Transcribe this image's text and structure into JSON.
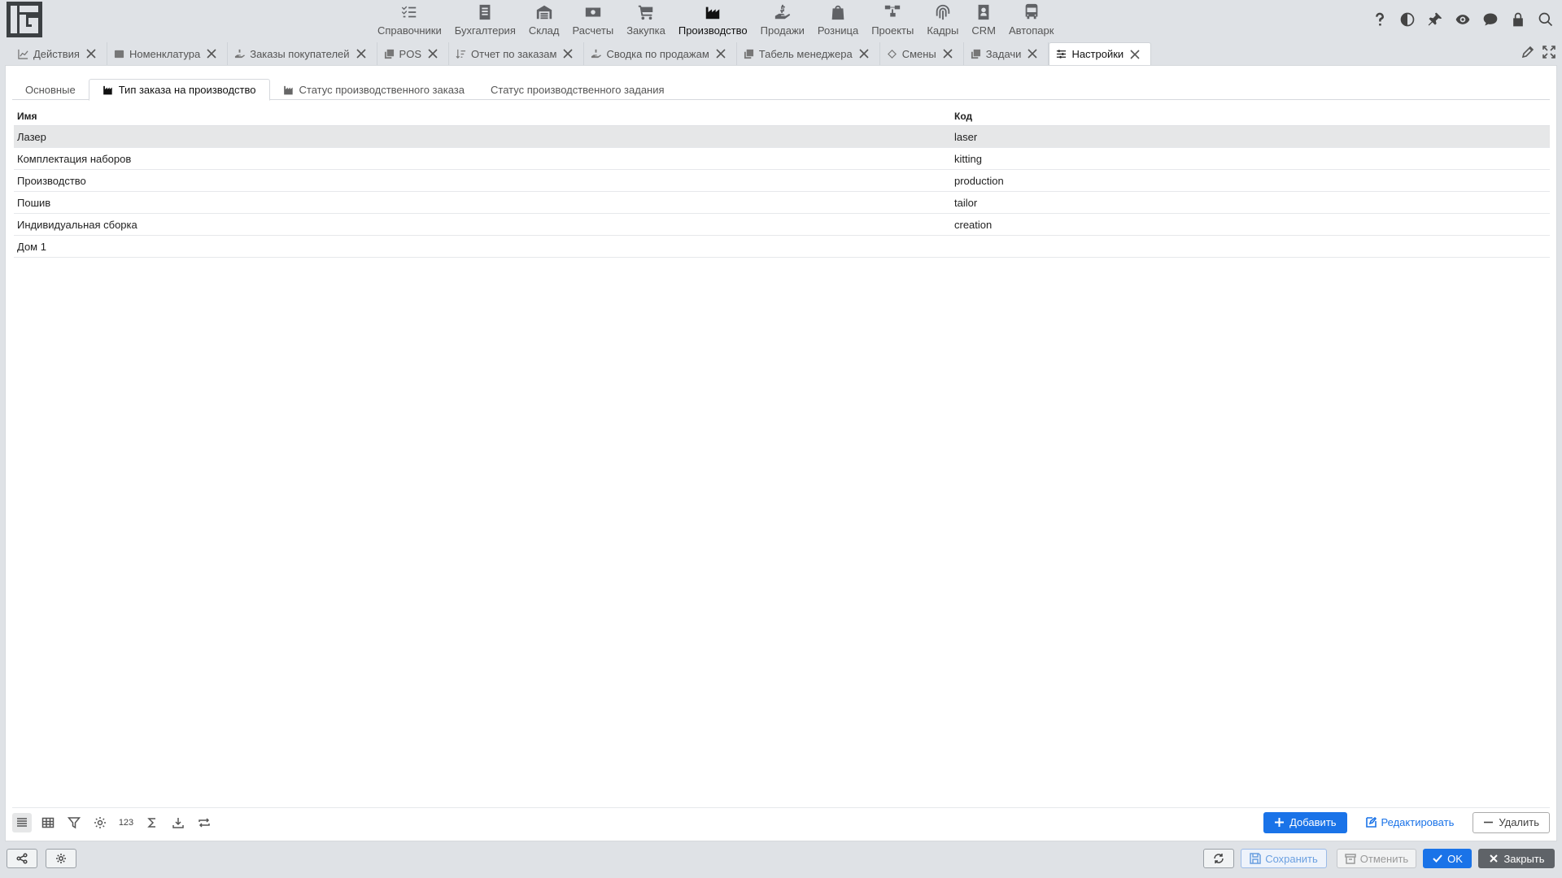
{
  "modules": [
    {
      "label": "Справочники",
      "icon": "checklist-icon"
    },
    {
      "label": "Бухгалтерия",
      "icon": "ledger-icon"
    },
    {
      "label": "Склад",
      "icon": "warehouse-icon"
    },
    {
      "label": "Расчеты",
      "icon": "money-icon"
    },
    {
      "label": "Закупка",
      "icon": "cart-icon"
    },
    {
      "label": "Производство",
      "icon": "factory-icon",
      "active": true
    },
    {
      "label": "Продажи",
      "icon": "hand-money-icon"
    },
    {
      "label": "Розница",
      "icon": "shopping-bag-icon"
    },
    {
      "label": "Проекты",
      "icon": "project-tree-icon"
    },
    {
      "label": "Кадры",
      "icon": "fingerprint-icon"
    },
    {
      "label": "CRM",
      "icon": "contact-card-icon"
    },
    {
      "label": "Автопарк",
      "icon": "bus-icon"
    }
  ],
  "doc_tabs": [
    {
      "label": "Действия",
      "icon": "chart-line-icon"
    },
    {
      "label": "Номенклатура",
      "icon": "catalog-icon"
    },
    {
      "label": "Заказы покупателей",
      "icon": "hand-money-icon"
    },
    {
      "label": "POS",
      "icon": "copy-icon"
    },
    {
      "label": "Отчет по заказам",
      "icon": "sort-icon"
    },
    {
      "label": "Сводка по продажам",
      "icon": "hand-money-icon"
    },
    {
      "label": "Табель менеджера",
      "icon": "copy-icon"
    },
    {
      "label": "Смены",
      "icon": "refresh-icon"
    },
    {
      "label": "Задачи",
      "icon": "copy-icon"
    },
    {
      "label": "Настройки",
      "icon": "sliders-icon",
      "active": true
    }
  ],
  "sub_tabs": [
    {
      "label": "Основные"
    },
    {
      "label": "Тип заказа на производство",
      "active": true
    },
    {
      "label": "Статус производственного заказа"
    },
    {
      "label": "Статус производственного задания"
    }
  ],
  "table": {
    "headers": [
      "Имя",
      "Код"
    ],
    "rows": [
      [
        "Лазер",
        "laser"
      ],
      [
        "Комплектация наборов",
        "kitting"
      ],
      [
        "Производство",
        "production"
      ],
      [
        "Пошив",
        "tailor"
      ],
      [
        "Индивидуальная сборка",
        "creation"
      ],
      [
        "Дом 1",
        ""
      ]
    ]
  },
  "bottom_tools": {
    "numbers_label": "123"
  },
  "actions": {
    "add": "Добавить",
    "edit": "Редактировать",
    "delete": "Удалить"
  },
  "footer": {
    "save": "Сохранить",
    "cancel": "Отменить",
    "ok": "OK",
    "close": "Закрыть"
  },
  "colors": {
    "primary": "#1a73e8",
    "selected_row": "#e6e7e8",
    "close_button": "#5f6368"
  }
}
